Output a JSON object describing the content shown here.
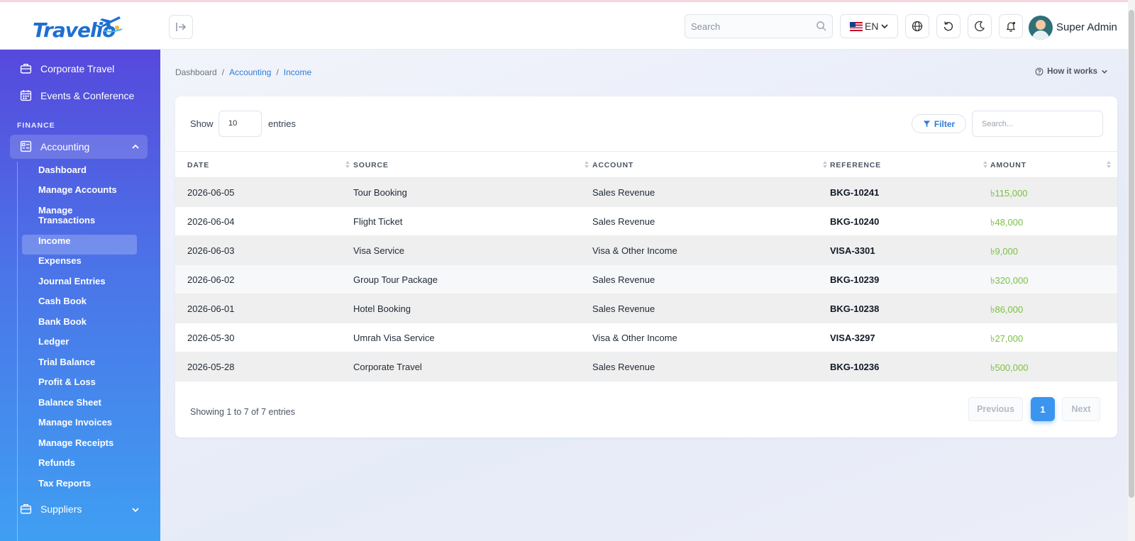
{
  "brand": {
    "logo_text": "Travelio"
  },
  "topbar": {
    "search_placeholder": "Search",
    "language": "EN",
    "user_name": "Super Admin"
  },
  "sidebar": {
    "top_items": [
      {
        "label": "Corporate Travel",
        "icon": "briefcase-icon"
      },
      {
        "label": "Events & Conference",
        "icon": "calendar-icon"
      }
    ],
    "section_label": "FINANCE",
    "group": {
      "label": "Accounting",
      "icon": "ledger-icon",
      "expanded": true
    },
    "sub_items": [
      {
        "label": "Dashboard"
      },
      {
        "label": "Manage Accounts"
      },
      {
        "label": "Manage Transactions"
      },
      {
        "label": "Income",
        "active": true
      },
      {
        "label": "Expenses"
      },
      {
        "label": "Journal Entries"
      },
      {
        "label": "Cash Book"
      },
      {
        "label": "Bank Book"
      },
      {
        "label": "Ledger"
      },
      {
        "label": "Trial Balance"
      },
      {
        "label": "Profit & Loss"
      },
      {
        "label": "Balance Sheet"
      },
      {
        "label": "Manage Invoices"
      },
      {
        "label": "Manage Receipts"
      },
      {
        "label": "Refunds"
      },
      {
        "label": "Tax Reports"
      }
    ],
    "bottom_item": {
      "label": "Suppliers",
      "icon": "briefcase-icon"
    }
  },
  "breadcrumb": {
    "items": [
      "Dashboard",
      "Accounting",
      "Income"
    ],
    "separator": "/"
  },
  "help": {
    "label": "How it works"
  },
  "table_controls": {
    "show_label": "Show",
    "page_size": "10",
    "entries_label": "entries",
    "filter_label": "Filter",
    "search_placeholder": "Search..."
  },
  "table": {
    "columns": [
      "DATE",
      "SOURCE",
      "ACCOUNT",
      "REFERENCE",
      "AMOUNT"
    ],
    "rows": [
      [
        "2026-06-05",
        "Tour Booking",
        "Sales Revenue",
        "BKG-10241",
        "৳115,000"
      ],
      [
        "2026-06-04",
        "Flight Ticket",
        "Sales Revenue",
        "BKG-10240",
        "৳48,000"
      ],
      [
        "2026-06-03",
        "Visa Service",
        "Visa & Other Income",
        "VISA-3301",
        "৳9,000"
      ],
      [
        "2026-06-02",
        "Group Tour Package",
        "Sales Revenue",
        "BKG-10239",
        "৳320,000"
      ],
      [
        "2026-06-01",
        "Hotel Booking",
        "Sales Revenue",
        "BKG-10238",
        "৳86,000"
      ],
      [
        "2026-05-30",
        "Umrah Visa Service",
        "Visa & Other Income",
        "VISA-3297",
        "৳27,000"
      ],
      [
        "2026-05-28",
        "Corporate Travel",
        "Sales Revenue",
        "BKG-10236",
        "৳500,000"
      ]
    ]
  },
  "footer": {
    "showing_text": "Showing 1 to 7 of 7 entries",
    "prev_label": "Previous",
    "current_page": "1",
    "next_label": "Next"
  },
  "colors": {
    "accent": "#2f7bd6",
    "amount": "#7ac142",
    "sidebar_top": "#5649dc",
    "sidebar_bottom": "#3f9ff2"
  }
}
